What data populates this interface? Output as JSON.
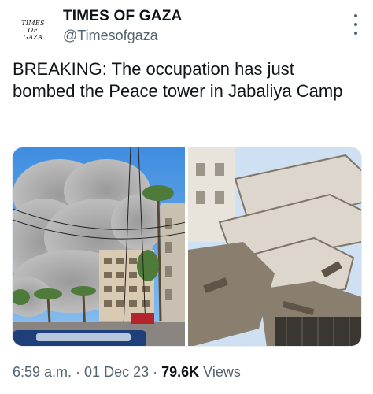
{
  "account": {
    "logo_lines": [
      "TIMES",
      "OF",
      "GAZA"
    ],
    "name": "TIMES OF GAZA",
    "handle": "@Timesofgaza"
  },
  "tweet": {
    "text": "BREAKING: The occupation has just bombed the Peace tower in Jabaliya Camp"
  },
  "icons": {
    "more": "more-vertical-icon"
  },
  "media": {
    "count": 2
  },
  "meta": {
    "time": "6:59 a.m.",
    "sep1": " · ",
    "date": "01 Dec 23",
    "sep2": " · ",
    "views_count": "79.6K",
    "views_label": " Views"
  }
}
